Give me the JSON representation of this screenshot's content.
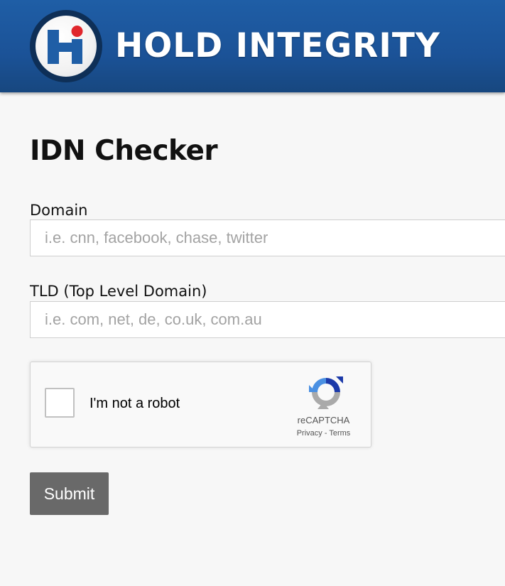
{
  "header": {
    "logo_icon": "hold-integrity-hi-logo",
    "brand_name": "HOLD INTEGRITY",
    "colors": {
      "bar": "#1b5297",
      "logo_blue": "#1f5ea6",
      "logo_red": "#e0262c"
    }
  },
  "page": {
    "title": "IDN Checker"
  },
  "form": {
    "domain": {
      "label": "Domain",
      "placeholder": "i.e. cnn, facebook, chase, twitter",
      "value": ""
    },
    "tld": {
      "label": "TLD (Top Level Domain)",
      "placeholder": "i.e. com, net, de, co.uk, com.au",
      "value": ""
    },
    "captcha": {
      "checkbox_label": "I'm not a robot",
      "checked": false,
      "brand": "reCAPTCHA",
      "privacy_link": "Privacy",
      "separator": " - ",
      "terms_link": "Terms",
      "logo_icon": "recaptcha-logo-icon"
    },
    "submit_label": "Submit",
    "submit_color": "#696969"
  }
}
